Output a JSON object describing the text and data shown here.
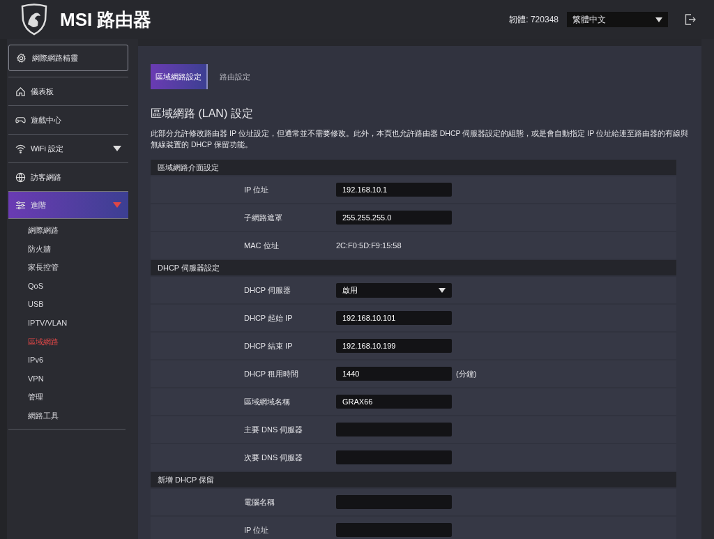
{
  "header": {
    "brand": "MSI 路由器",
    "firmware": "韌體: 720348",
    "language": "繁體中文"
  },
  "sidebar": {
    "wizard_button": "網際網路精靈",
    "items": [
      {
        "label": "儀表板",
        "selected": false
      },
      {
        "label": "遊戲中心",
        "selected": false
      },
      {
        "label": "WiFi 設定",
        "selected": false,
        "expanded": false
      },
      {
        "label": "訪客網路",
        "selected": false
      },
      {
        "label": "進階",
        "selected": true,
        "expanded": true,
        "children": [
          {
            "label": "網際網路",
            "selected": false
          },
          {
            "label": "防火牆",
            "selected": false
          },
          {
            "label": "家長控管",
            "selected": false
          },
          {
            "label": "QoS",
            "selected": false
          },
          {
            "label": "USB",
            "selected": false
          },
          {
            "label": "IPTV/VLAN",
            "selected": false
          },
          {
            "label": "區域網路",
            "selected": true
          },
          {
            "label": "IPv6",
            "selected": false
          },
          {
            "label": "VPN",
            "selected": false
          },
          {
            "label": "管理",
            "selected": false
          },
          {
            "label": "網路工具",
            "selected": false
          }
        ]
      }
    ]
  },
  "tabs": [
    {
      "label": "區域網路設定",
      "selected": true
    },
    {
      "label": "路由設定",
      "selected": false
    }
  ],
  "page": {
    "title": "區域網路 (LAN) 設定",
    "description": "此部分允許修改路由器 IP 位址設定，但通常並不需要修改。此外，本頁也允許路由器 DHCP 伺服器設定的組態，或是會自動指定 IP 位址給連至路由器的有線與無線裝置的 DHCP 保留功能。"
  },
  "sections": [
    {
      "title": "區域網路介面設定",
      "rows": [
        {
          "kind": "input",
          "label": "IP 位址",
          "value": "192.168.10.1"
        },
        {
          "kind": "input",
          "label": "子網路遮罩",
          "value": "255.255.255.0"
        },
        {
          "kind": "text",
          "label": "MAC 位址",
          "value": "2C:F0:5D:F9:15:58"
        }
      ]
    },
    {
      "title": "DHCP 伺服器設定",
      "rows": [
        {
          "kind": "select",
          "label": "DHCP 伺服器",
          "value": "啟用"
        },
        {
          "kind": "input",
          "label": "DHCP 起始 IP",
          "value": "192.168.10.101"
        },
        {
          "kind": "input",
          "label": "DHCP 結束 IP",
          "value": "192.168.10.199"
        },
        {
          "kind": "input",
          "label": "DHCP 租用時間",
          "value": "1440",
          "unit": "(分鐘)"
        },
        {
          "kind": "input",
          "label": "區域網域名稱",
          "value": "GRAX66"
        },
        {
          "kind": "input",
          "label": "主要 DNS 伺服器"
        },
        {
          "kind": "input",
          "label": "次要 DNS 伺服器"
        }
      ]
    },
    {
      "title": "新增 DHCP 保留",
      "rows": [
        {
          "kind": "input",
          "label": "電腦名稱"
        },
        {
          "kind": "input",
          "label": "IP 位址"
        }
      ]
    }
  ]
}
